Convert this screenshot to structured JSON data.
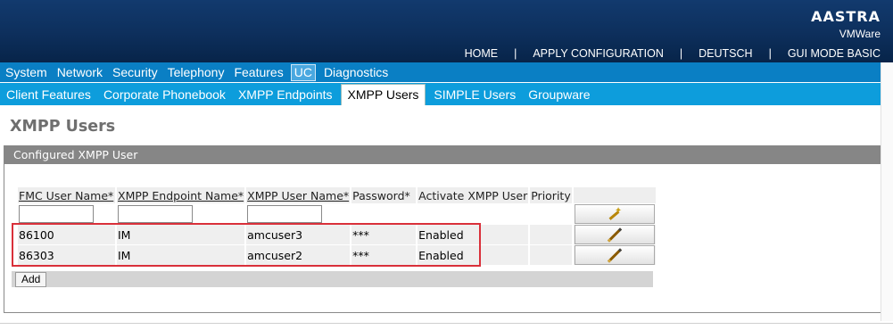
{
  "brand": {
    "logo": "AASTRA",
    "product": "VMWare"
  },
  "topnav": {
    "links": [
      "HOME",
      "APPLY CONFIGURATION",
      "DEUTSCH",
      "GUI MODE BASIC"
    ],
    "separator": "|"
  },
  "mainmenu": {
    "items": [
      "System",
      "Network",
      "Security",
      "Telephony",
      "Features",
      "UC",
      "Diagnostics"
    ],
    "active": "UC"
  },
  "submenu": {
    "items": [
      "Client Features",
      "Corporate Phonebook",
      "XMPP Endpoints",
      "XMPP Users",
      "SIMPLE Users",
      "Groupware"
    ],
    "active": "XMPP Users"
  },
  "page": {
    "title": "XMPP Users"
  },
  "panel": {
    "title": "Configured XMPP User"
  },
  "table": {
    "columns": [
      "FMC User Name*",
      "XMPP Endpoint Name*",
      "XMPP User Name*",
      "Password*",
      "Activate XMPP User",
      "Priority",
      ""
    ],
    "filter_values": [
      "",
      "",
      ""
    ],
    "rows": [
      {
        "fmc_user": "86100",
        "endpoint": "IM",
        "xmpp_user": "amcuser3",
        "password": "***",
        "active": "Enabled",
        "priority": ""
      },
      {
        "fmc_user": "86303",
        "endpoint": "IM",
        "xmpp_user": "amcuser2",
        "password": "***",
        "active": "Enabled",
        "priority": ""
      }
    ],
    "filter_button_icon": "magic-wand-icon",
    "edit_button_icon": "pencil-icon"
  },
  "actions": {
    "add_label": "Add"
  },
  "colors": {
    "header_bg": "#0d2f5c",
    "menu_bg": "#0a7fc4",
    "submenu_bg": "#0d9ddc",
    "panel_head": "#868686",
    "highlight_border": "#d9303a"
  }
}
